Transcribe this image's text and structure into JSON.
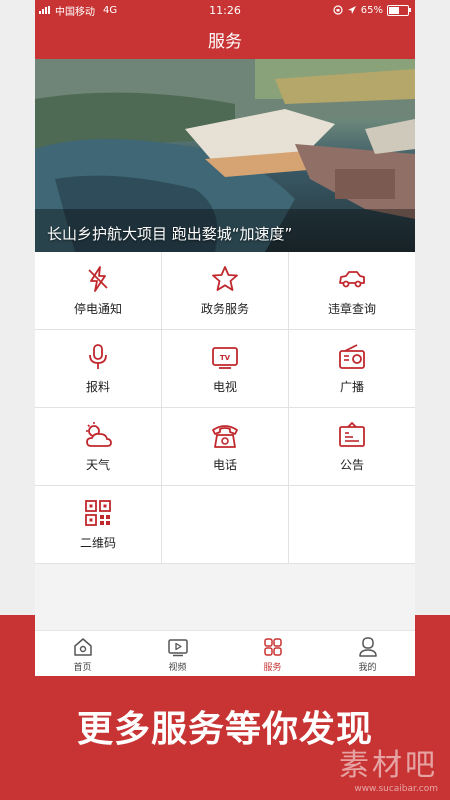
{
  "status_bar": {
    "carrier": "中国移动",
    "network": "4G",
    "time": "11:26",
    "battery": "65%",
    "battery_level": 0.65
  },
  "nav": {
    "title": "服务"
  },
  "banner": {
    "caption": "长山乡护航大项目 跑出婺城“加速度”"
  },
  "services": [
    {
      "label": "停电通知",
      "icon": "lightning-off-icon"
    },
    {
      "label": "政务服务",
      "icon": "star-icon"
    },
    {
      "label": "违章查询",
      "icon": "car-icon"
    },
    {
      "label": "报料",
      "icon": "microphone-icon"
    },
    {
      "label": "电视",
      "icon": "tv-icon"
    },
    {
      "label": "广播",
      "icon": "radio-icon"
    },
    {
      "label": "天气",
      "icon": "weather-icon"
    },
    {
      "label": "电话",
      "icon": "telephone-icon"
    },
    {
      "label": "公告",
      "icon": "notice-icon"
    },
    {
      "label": "二维码",
      "icon": "qrcode-icon"
    }
  ],
  "tabs": [
    {
      "label": "首页",
      "icon": "home-icon"
    },
    {
      "label": "视频",
      "icon": "video-icon"
    },
    {
      "label": "服务",
      "icon": "grid-icon",
      "active": true
    },
    {
      "label": "我的",
      "icon": "user-icon"
    }
  ],
  "promo": {
    "text": "更多服务等你发现"
  },
  "watermark": {
    "text": "素材吧",
    "url": "www.sucaibar.com"
  },
  "colors": {
    "brand": "#c83434",
    "icon_red": "#c0282d",
    "inactive": "#555555"
  }
}
